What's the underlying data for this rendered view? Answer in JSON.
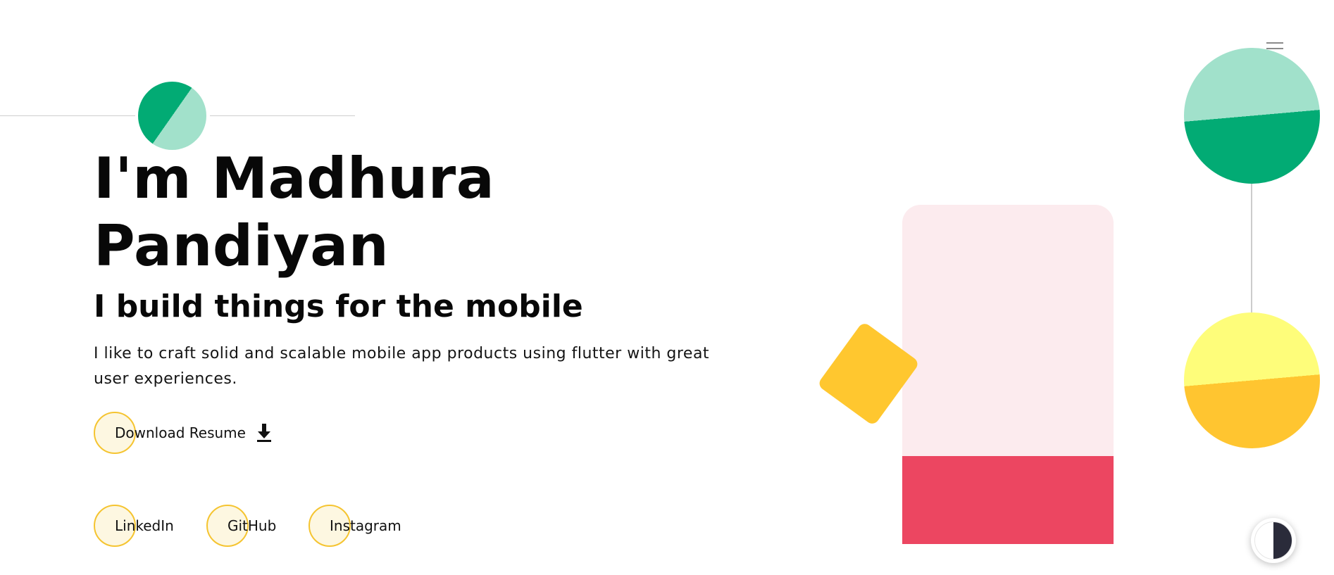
{
  "hero": {
    "title": "I'm Madhura Pandiyan",
    "subtitle": "I build things for the mobile",
    "description": "I like to craft solid and scalable mobile app products using flutter with great user experiences."
  },
  "actions": {
    "download_label": "Download Resume",
    "download_icon": "download-icon"
  },
  "social": [
    {
      "label": "LinkedIn"
    },
    {
      "label": "GitHub"
    },
    {
      "label": "Instagram"
    }
  ],
  "icons": {
    "menu": "hamburger-menu-icon",
    "theme": "theme-toggle-icon"
  },
  "colors": {
    "green": "#02ab74",
    "mint": "#a2e1cb",
    "yellow": "#ffc72f",
    "light_yellow": "#fefd7a",
    "pink": "#fcebee",
    "red": "#ec4661",
    "ring": "#f5c430"
  }
}
